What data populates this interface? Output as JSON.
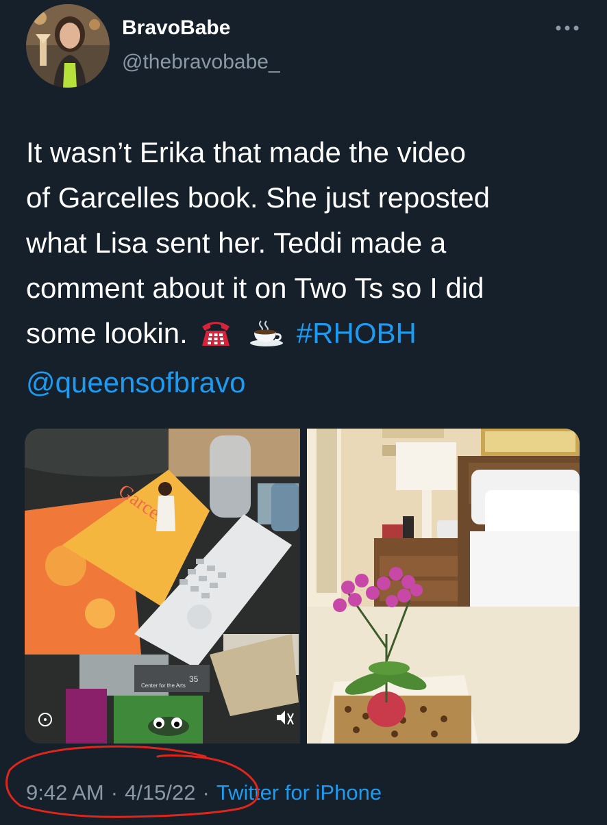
{
  "author": {
    "name": "BravoBabe",
    "handle": "@thebravobabe_",
    "avatar_icon": "profile-photo"
  },
  "more_icon": "ellipsis-icon",
  "tweet": {
    "line1": "It wasn’t Erika that made the video",
    "line2": "of Garcelles book. She just reposted",
    "line3": "what Lisa sent her. Teddi made a",
    "line4": "comment about it on Two Ts so I did",
    "line5_text": "some lookin.",
    "emoji_1": "telephone-icon",
    "emoji_2": "coffee-icon",
    "hashtag": "#RHOBH",
    "mention": "@queensofbravo"
  },
  "media": {
    "left_image": {
      "book_title": "Garcelle",
      "icon": "trash-bin-photo",
      "label_text": "Center for the Arts",
      "label_number": "35"
    },
    "right_image": {
      "icon": "bedroom-photo"
    }
  },
  "meta": {
    "time": "9:42 AM",
    "dot1": "·",
    "date": "4/15/22",
    "dot2": "·",
    "source": "Twitter for iPhone"
  },
  "colors": {
    "background": "#15202b",
    "text": "#ffffff",
    "secondary": "#8b98a5",
    "link": "#1d9bf0",
    "annotation": "#e0251b"
  }
}
